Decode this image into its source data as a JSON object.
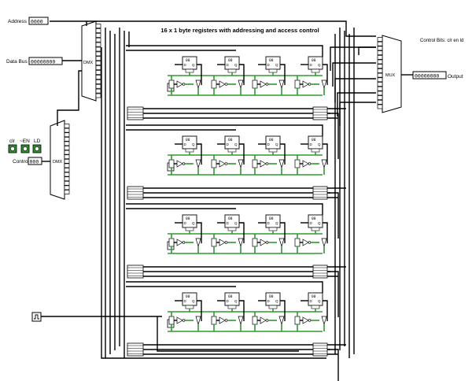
{
  "title": "16 x 1 byte registers with addressing and access control",
  "inputs": {
    "address": {
      "label": "Address",
      "value": "0000"
    },
    "data_bus": {
      "label": "Data Bus",
      "value": "00000000"
    },
    "control": {
      "label": "Control",
      "value": "000"
    },
    "buttons": [
      "clr",
      "~EN",
      "LD"
    ]
  },
  "output": {
    "label": "Output",
    "value": "00000000"
  },
  "control_bits_note": "Control Bits: clr en ld",
  "components": {
    "demux_label": "DMX",
    "mux_label": "MUX",
    "register_value": "00",
    "ff_d": "D",
    "ff_q": "Q"
  },
  "colors": {
    "wire": "#000000",
    "active_wire": "#2e9a2e",
    "button": "#2f8f2f",
    "background": "#ffffff"
  }
}
